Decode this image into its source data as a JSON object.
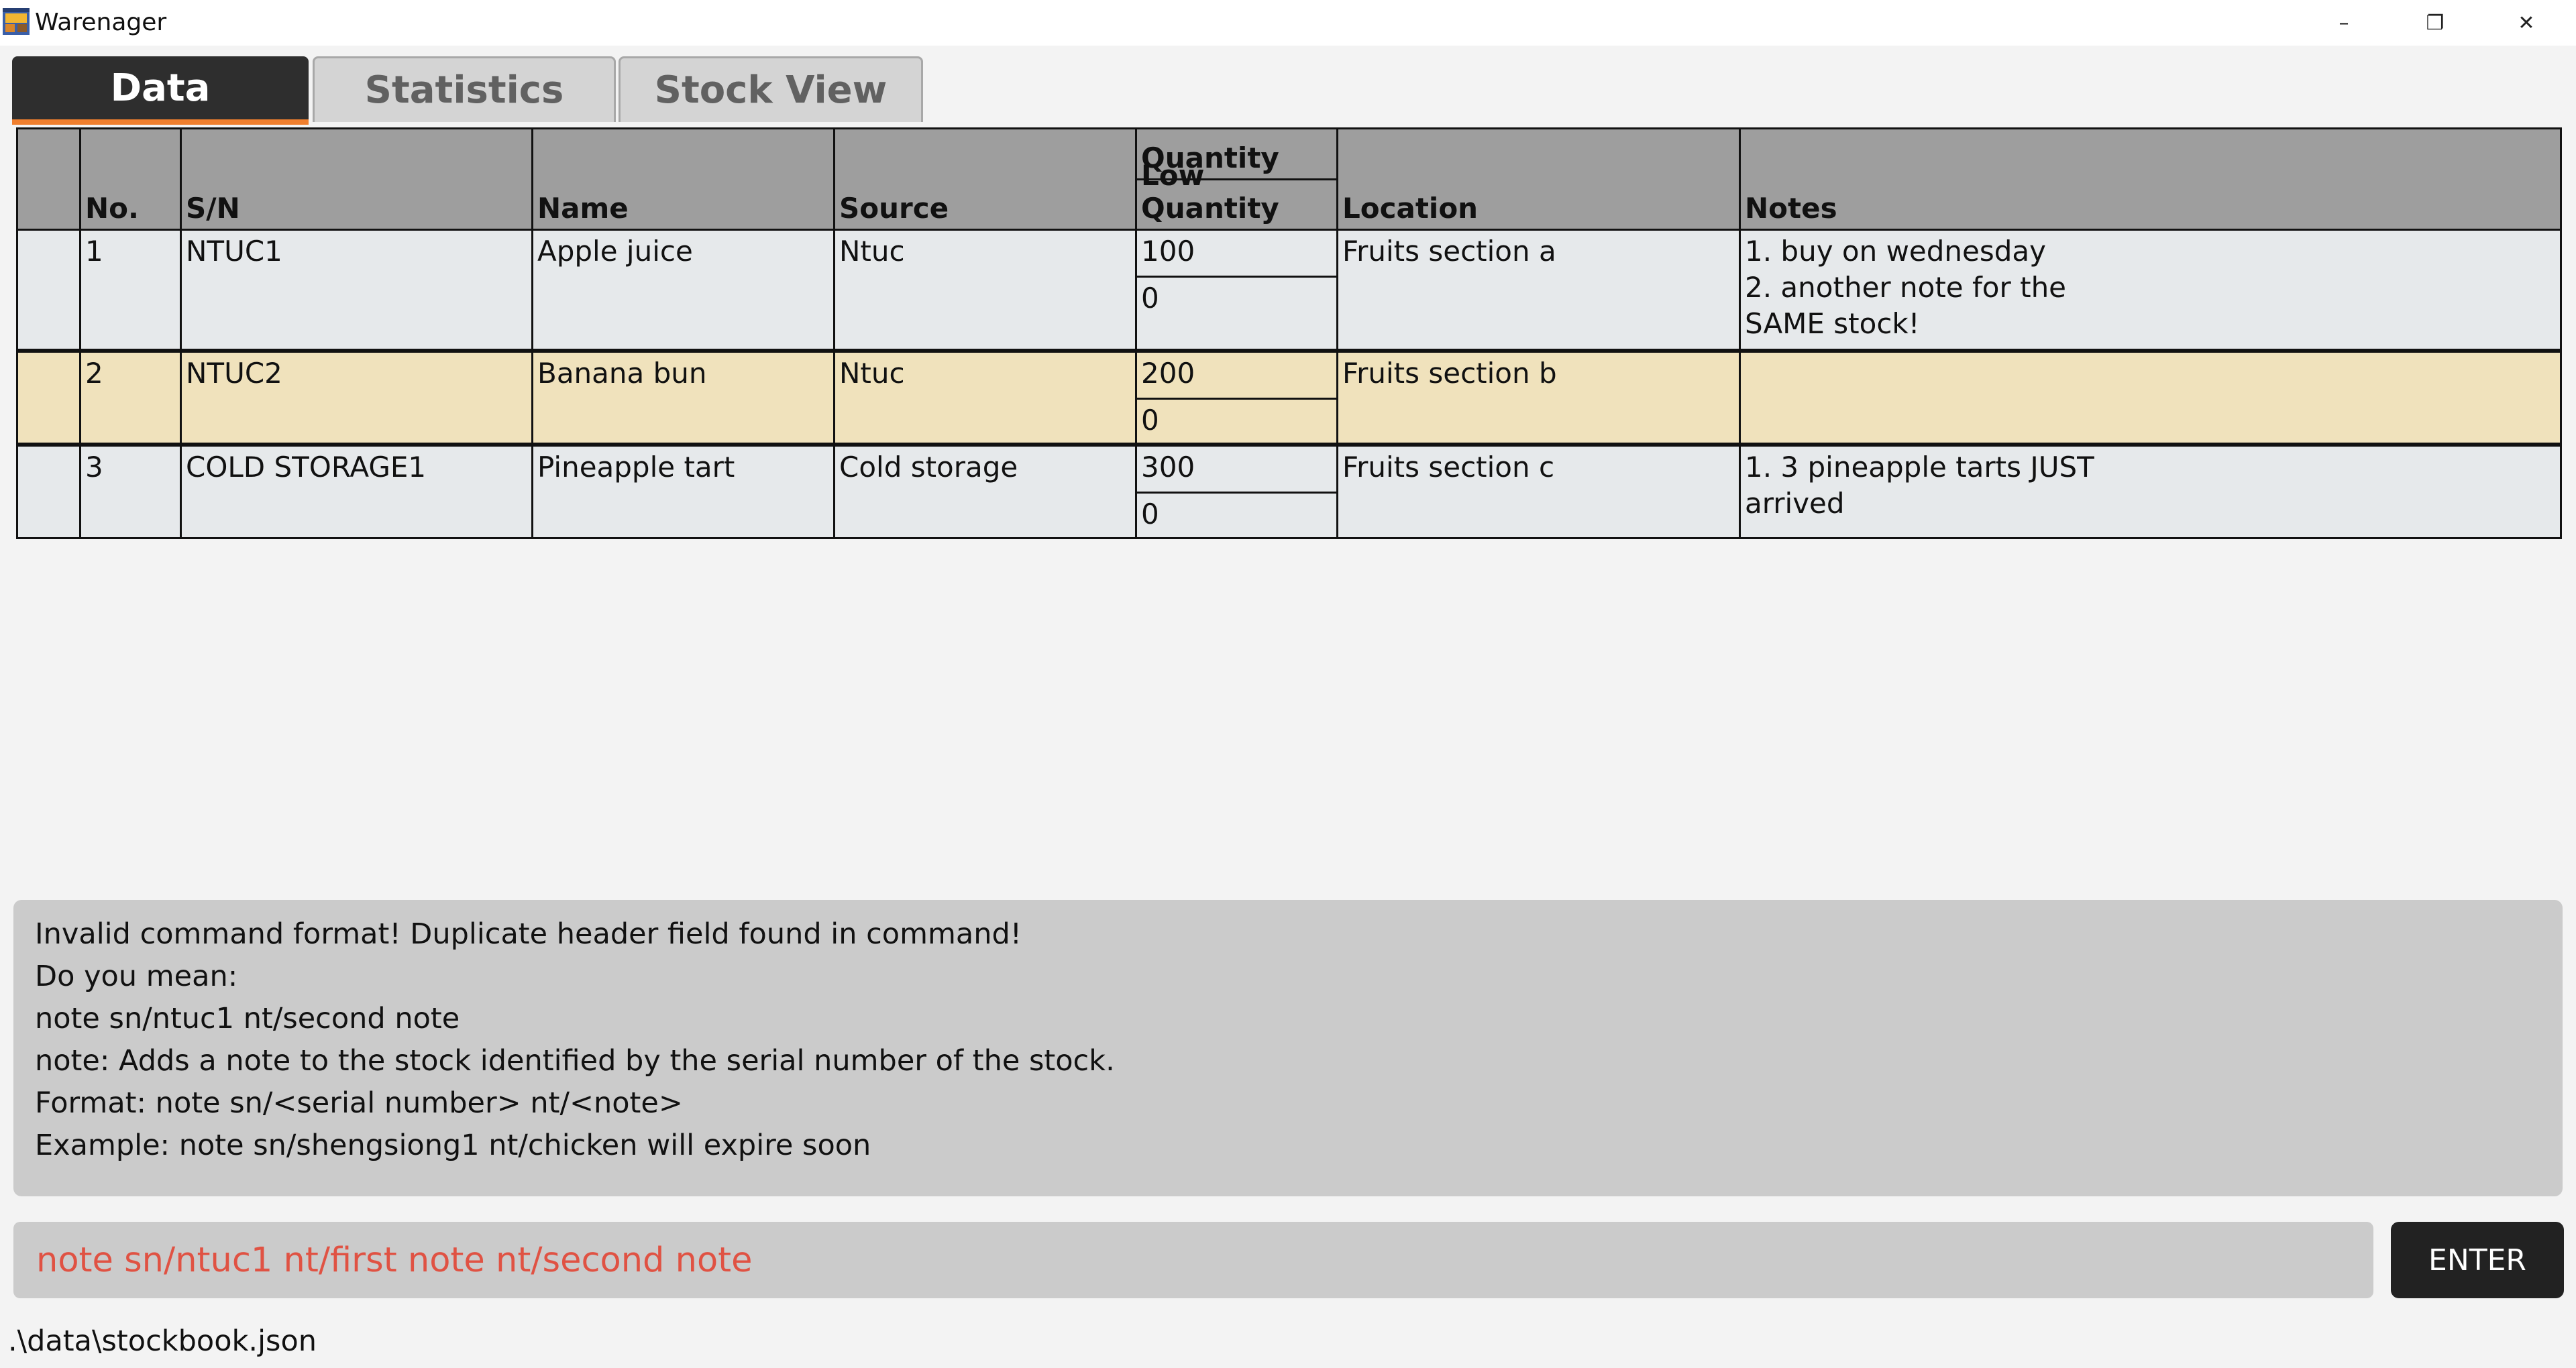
{
  "window": {
    "title": "Warenager",
    "controls": {
      "minimize": "–",
      "restore": "❐",
      "close": "✕"
    }
  },
  "tabs": [
    {
      "label": "Data",
      "active": true
    },
    {
      "label": "Statistics",
      "active": false
    },
    {
      "label": "Stock View",
      "active": false
    }
  ],
  "table": {
    "headers": {
      "no": "No.",
      "sn": "S/N",
      "name": "Name",
      "source": "Source",
      "quantity": "Quantity",
      "low_quantity": "Low Quantity",
      "location": "Location",
      "notes": "Notes"
    },
    "rows": [
      {
        "no": "1",
        "sn": "NTUC1",
        "name": "Apple juice",
        "source": "Ntuc",
        "quantity": "100",
        "low_quantity": "0",
        "location": "Fruits section a",
        "notes": [
          "1. buy on wednesday",
          "2. another note for the",
          "SAME stock!"
        ]
      },
      {
        "no": "2",
        "sn": "NTUC2",
        "name": "Banana bun",
        "source": "Ntuc",
        "quantity": "200",
        "low_quantity": "0",
        "location": "Fruits section b",
        "notes": []
      },
      {
        "no": "3",
        "sn": "COLD STORAGE1",
        "name": "Pineapple tart",
        "source": "Cold storage",
        "quantity": "300",
        "low_quantity": "0",
        "location": "Fruits section c",
        "notes": [
          "1. 3 pineapple tarts JUST",
          "arrived"
        ]
      }
    ]
  },
  "result": {
    "lines": [
      "Invalid command format! Duplicate header field found in command!",
      "Do you mean:",
      "note sn/ntuc1 nt/second note",
      "note: Adds a note to the stock identified by the serial number of the stock.",
      "Format: note sn/<serial number> nt/<note>",
      "Example: note sn/shengsiong1 nt/chicken will expire soon"
    ]
  },
  "command": {
    "value": "note sn/ntuc1 nt/first note nt/second note",
    "enter_label": "ENTER"
  },
  "status": {
    "path": ".\\data\\stockbook.json"
  },
  "colors": {
    "active_tab": "#2e2e2e",
    "tab_underline": "#f07f2e",
    "header_bg": "#9e9e9e",
    "selected_row": "#f0e2bc",
    "command_error_text": "#e05243"
  }
}
